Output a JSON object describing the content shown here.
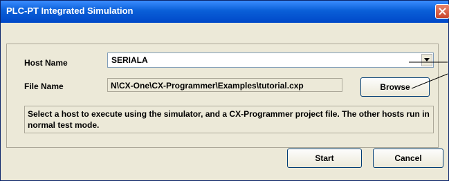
{
  "window": {
    "title": "PLC-PT Integrated Simulation",
    "close_icon": "close-icon"
  },
  "form": {
    "host_label": "Host Name",
    "host_value": "SERIALA",
    "file_label": "File Name",
    "file_value": "N\\CX-One\\CX-Programmer\\Examples\\tutorial.cxp",
    "browse_label": "Browse",
    "info_text": "Select a host to execute using the simulator, and a CX-Programmer project file. The other hosts run in normal test mode."
  },
  "buttons": {
    "start_label": "Start",
    "cancel_label": "Cancel"
  },
  "colors": {
    "titlebar": "#0a5fd8",
    "dialog_bg": "#ece9d8",
    "close_button": "#c8452c"
  }
}
